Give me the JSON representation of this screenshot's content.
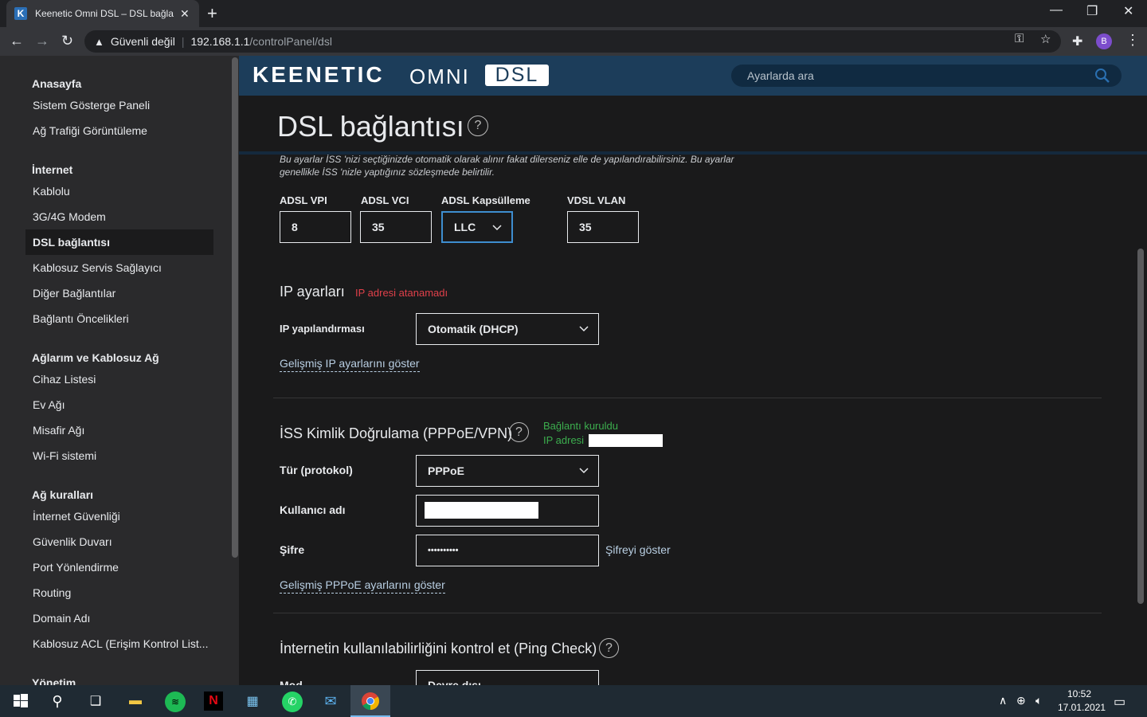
{
  "browser": {
    "tab_title": "Keenetic Omni DSL – DSL bağlantısı",
    "new_tab": "+",
    "security_label": "Güvenli değil",
    "url_host": "192.168.1.1",
    "url_path": "/controlPanel/dsl",
    "avatar_letter": "B"
  },
  "brand": {
    "keenetic": "KEENETIC",
    "omni": "OMNI",
    "dsl": "DSL"
  },
  "search": {
    "placeholder": "Ayarlarda ara"
  },
  "sidebar": {
    "sections": [
      {
        "title": "Anasayfa",
        "items": [
          "Sistem Gösterge Paneli",
          "Ağ Trafiği Görüntüleme"
        ]
      },
      {
        "title": "İnternet",
        "items": [
          "Kablolu",
          "3G/4G Modem",
          "DSL bağlantısı",
          "Kablosuz Servis Sağlayıcı",
          "Diğer Bağlantılar",
          "Bağlantı Öncelikleri"
        ]
      },
      {
        "title": "Ağlarım ve Kablosuz Ağ",
        "items": [
          "Cihaz Listesi",
          "Ev Ağı",
          "Misafir Ağı",
          "Wi-Fi sistemi"
        ]
      },
      {
        "title": "Ağ kuralları",
        "items": [
          "İnternet Güvenliği",
          "Güvenlik Duvarı",
          "Port Yönlendirme",
          "Routing",
          "Domain Adı",
          "Kablosuz ACL (Erişim Kontrol List..."
        ]
      },
      {
        "title": "Yönetim",
        "items": []
      }
    ],
    "active_item": "DSL bağlantısı"
  },
  "page": {
    "title": "DSL bağlantısı",
    "description": "Bu ayarlar İSS 'nizi seçtiğinizde otomatik olarak alınır fakat dilerseniz elle de yapılandırabilirsiniz. Bu ayarlar genellikle İSS 'nizle yaptığınız sözleşmede belirtilir."
  },
  "dsl": {
    "vpi_label": "ADSL VPI",
    "vpi_value": "8",
    "vci_label": "ADSL VCI",
    "vci_value": "35",
    "encap_label": "ADSL Kapsülleme",
    "encap_value": "LLC",
    "vlan_label": "VDSL VLAN",
    "vlan_value": "35"
  },
  "ip": {
    "title": "IP ayarları",
    "error": "IP adresi atanamadı",
    "config_label": "IP yapılandırması",
    "config_value": "Otomatik (DHCP)",
    "advanced_link": "Gelişmiş IP ayarlarını göster"
  },
  "pppoe": {
    "title": "İSS Kimlik Doğrulama (PPPoE/VPN)",
    "status": "Bağlantı kuruldu",
    "ip_label": "IP adresi",
    "type_label": "Tür (protokol)",
    "type_value": "PPPoE",
    "user_label": "Kullanıcı adı",
    "pass_label": "Şifre",
    "pass_value": "••••••••••",
    "show_pass": "Şifreyi göster",
    "advanced_link": "Gelişmiş PPPoE ayarlarını göster"
  },
  "ping": {
    "title": "İnternetin kullanılabilirliğini kontrol et (Ping Check)",
    "mode_label": "Mod",
    "mode_value": "Devre dışı"
  },
  "taskbar": {
    "time": "10:52",
    "date": "17.01.2021"
  }
}
